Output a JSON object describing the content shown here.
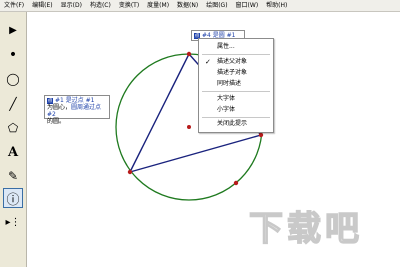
{
  "menubar": {
    "items": [
      "文件(F)",
      "编辑(E)",
      "显示(D)",
      "构造(C)",
      "变换(T)",
      "度量(M)",
      "数据(N)",
      "绘图(G)",
      "窗口(W)",
      "帮助(H)"
    ]
  },
  "toolbar": {
    "tools": [
      {
        "name": "arrow-tool",
        "glyph": "▶"
      },
      {
        "name": "point-tool",
        "glyph": "•"
      },
      {
        "name": "compass-tool",
        "glyph": "◯"
      },
      {
        "name": "line-tool",
        "glyph": "╱"
      },
      {
        "name": "polygon-tool",
        "glyph": "⬠"
      },
      {
        "name": "text-tool",
        "glyph": "A"
      },
      {
        "name": "marker-tool",
        "glyph": "✎"
      },
      {
        "name": "info-tool",
        "glyph": "ⓘ"
      },
      {
        "name": "custom-tool",
        "glyph": "▸⋮"
      }
    ]
  },
  "callout_left": {
    "icon": "点",
    "title": "#1 是过点 #1",
    "line2_prefix": "为圆心，",
    "line2_link": "圆周通过点 #2",
    "line3": "的圆。"
  },
  "callout_top": {
    "icon": "点",
    "title": "#4 是圆 #1"
  },
  "context_menu": {
    "items": [
      "属性...",
      "描述父对象",
      "描述子对象",
      "同时描述",
      "大字体",
      "小字体",
      "关闭此提示"
    ],
    "checked_index": 1
  },
  "colors": {
    "circle": "#1f7a1f",
    "segments": "#1a237e",
    "points": "#b71c1c",
    "accent": "#1c3fa8"
  },
  "watermark": "下载吧"
}
